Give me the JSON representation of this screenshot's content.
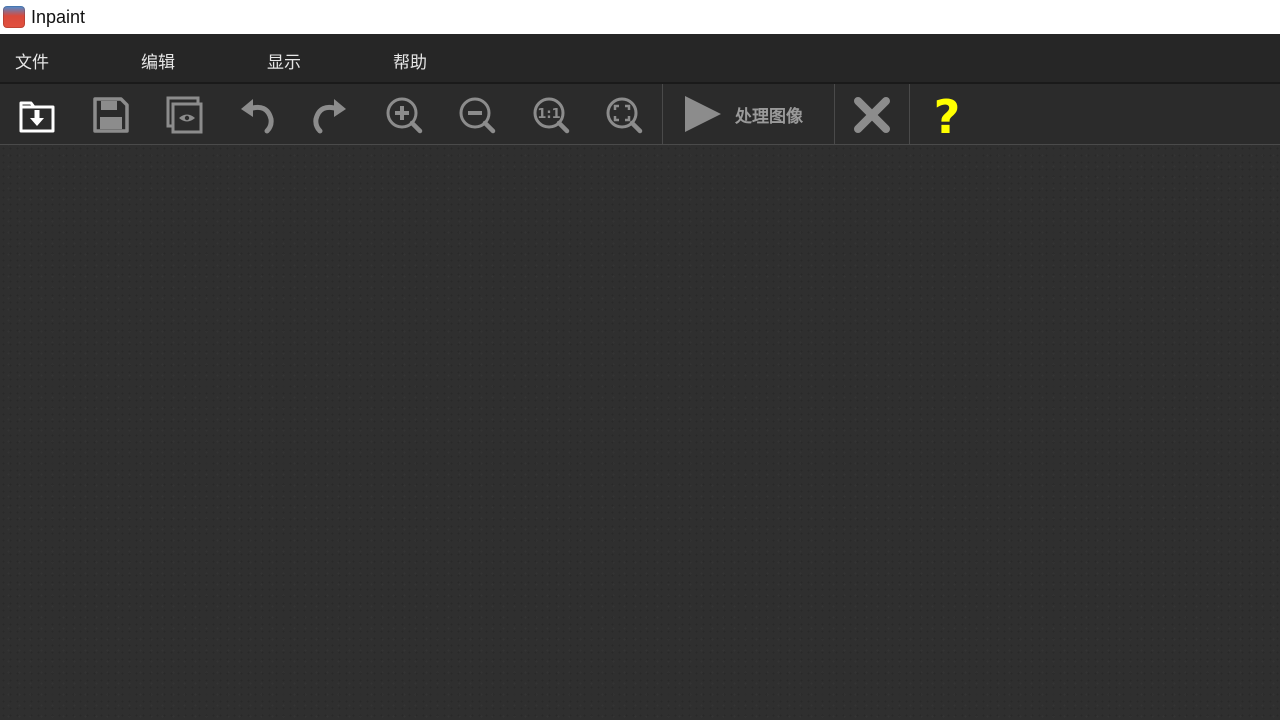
{
  "window": {
    "title": "Inpaint",
    "icon": "inpaint-app-icon"
  },
  "menu": [
    {
      "label": "文件"
    },
    {
      "label": "编辑"
    },
    {
      "label": "显示"
    },
    {
      "label": "帮助"
    }
  ],
  "toolbar": {
    "open": {
      "icon": "open-folder-icon"
    },
    "save": {
      "icon": "save-disk-icon"
    },
    "preview": {
      "icon": "preview-eye-icon"
    },
    "undo": {
      "icon": "undo-icon"
    },
    "redo": {
      "icon": "redo-icon"
    },
    "zoom_in": {
      "icon": "zoom-in-icon"
    },
    "zoom_out": {
      "icon": "zoom-out-icon"
    },
    "zoom_actual": {
      "icon": "zoom-actual-size-icon",
      "text": "1:1"
    },
    "zoom_fit": {
      "icon": "zoom-fit-icon"
    },
    "process": {
      "icon": "play-icon",
      "label": "处理图像"
    },
    "cancel": {
      "icon": "close-x-icon"
    },
    "help": {
      "icon": "help-question-icon",
      "text": "?"
    }
  },
  "colors": {
    "titlebar_bg": "#ffffff",
    "menubar_bg": "#262626",
    "toolbar_bg": "#2b2b2b",
    "canvas_bg": "#2f2f2f",
    "icon_gray": "#8c8c8c",
    "icon_white": "#ffffff",
    "help_yellow": "#ffff00"
  }
}
